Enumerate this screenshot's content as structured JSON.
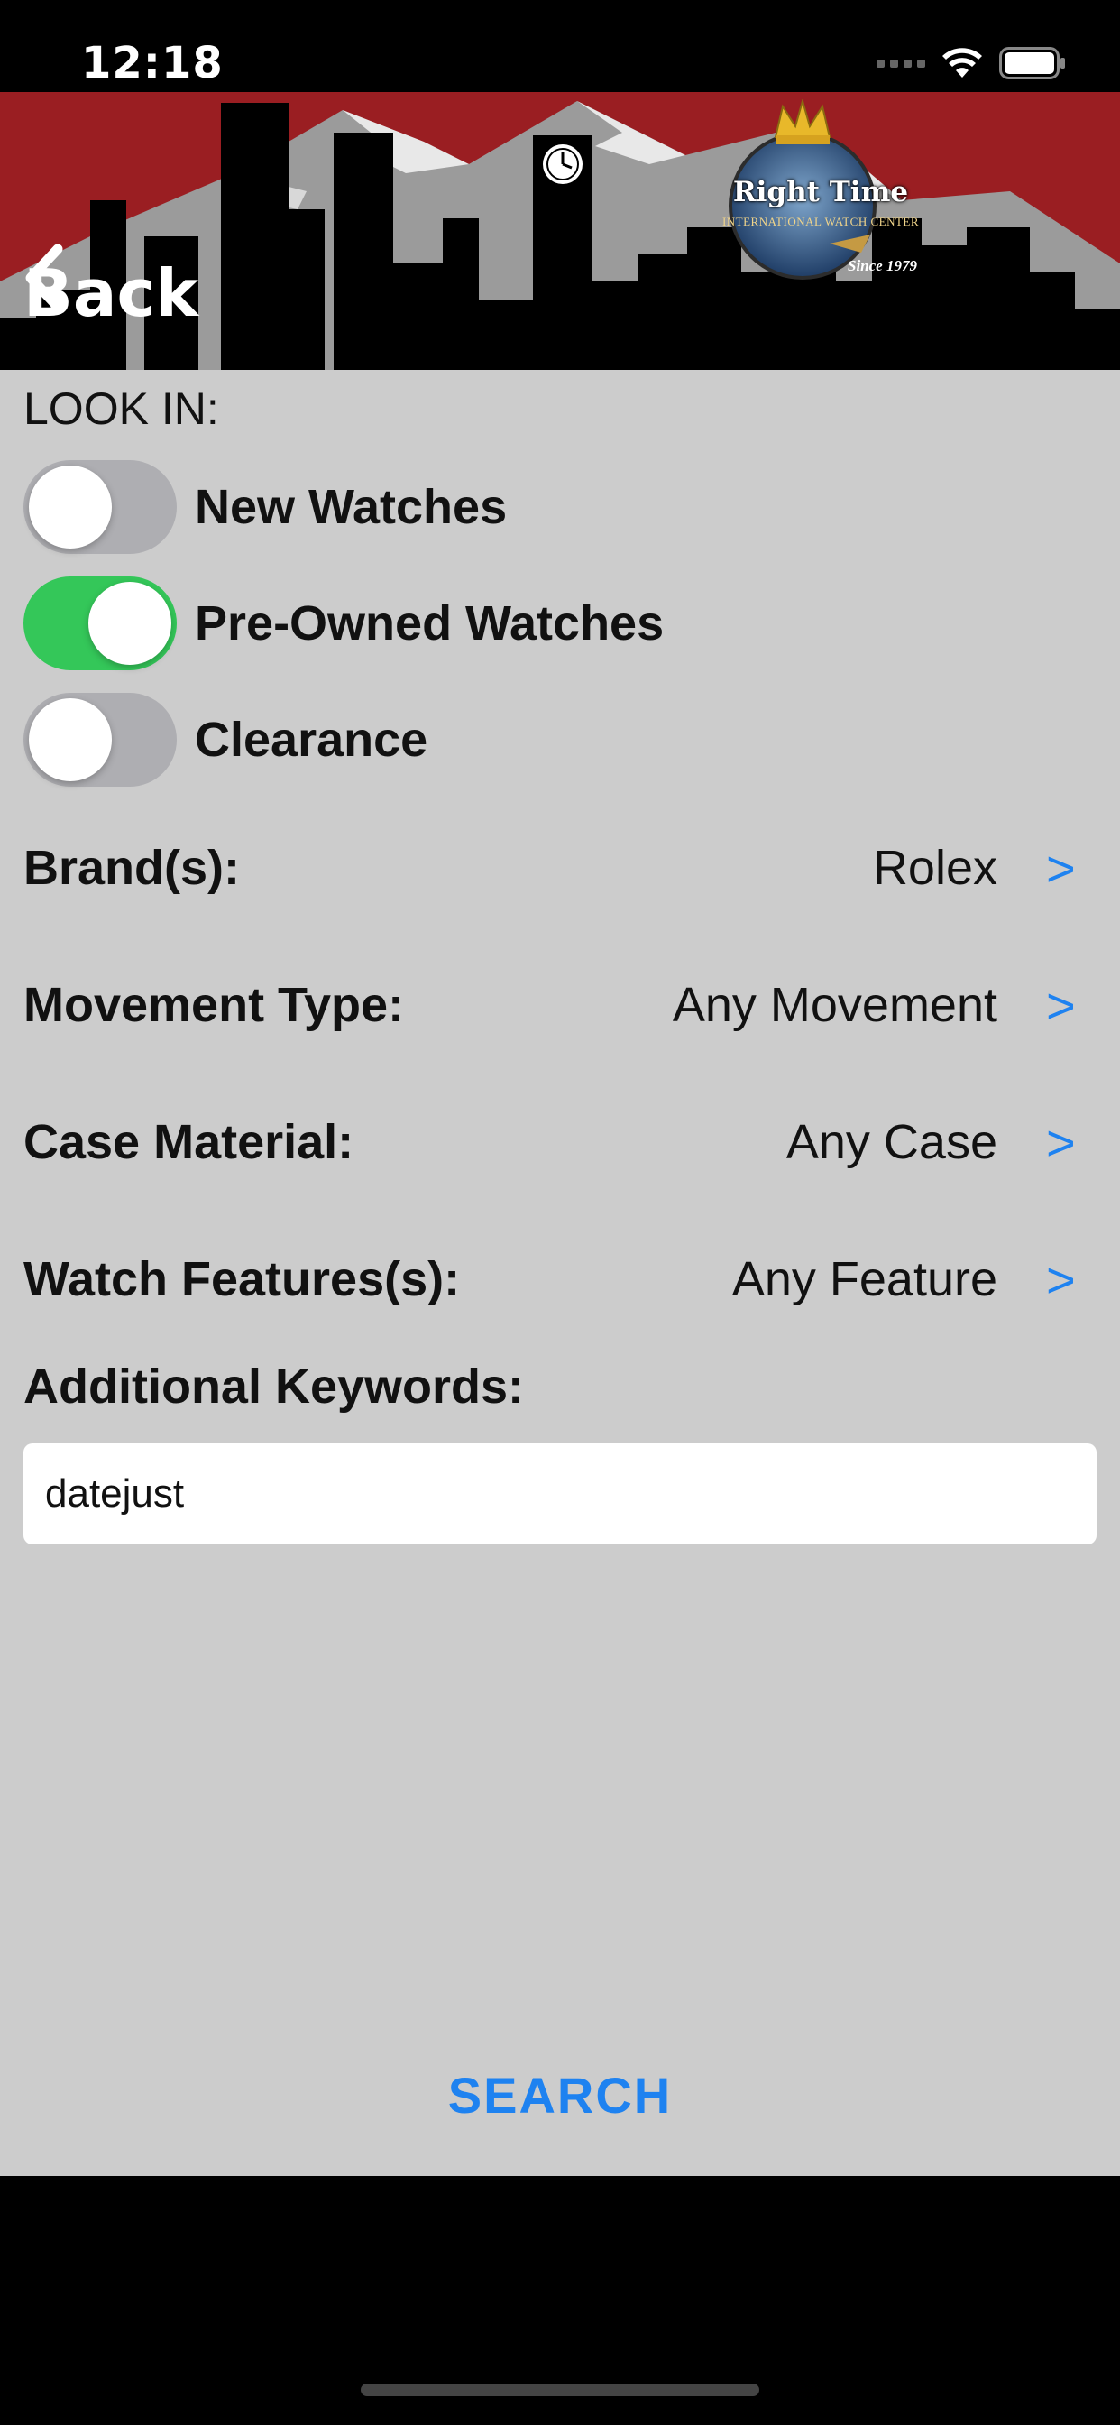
{
  "status_bar": {
    "time": "12:18"
  },
  "header": {
    "back_label": "Back",
    "logo": {
      "name": "Right Time",
      "subtitle": "INTERNATIONAL WATCH CENTER",
      "since": "Since 1979"
    }
  },
  "look_in": {
    "label": "LOOK IN:",
    "toggles": [
      {
        "label": "New Watches",
        "on": false
      },
      {
        "label": "Pre-Owned Watches",
        "on": true
      },
      {
        "label": "Clearance",
        "on": false
      }
    ]
  },
  "filters": [
    {
      "label": "Brand(s):",
      "value": "Rolex",
      "arrow": ">"
    },
    {
      "label": "Movement Type:",
      "value": "Any Movement",
      "arrow": ">"
    },
    {
      "label": "Case Material:",
      "value": "Any Case",
      "arrow": ">"
    },
    {
      "label": "Watch Features(s):",
      "value": "Any Feature",
      "arrow": ">"
    }
  ],
  "keywords": {
    "label": "Additional Keywords:",
    "value": "datejust"
  },
  "search_label": "SEARCH",
  "colors": {
    "header_red": "#9a1e22",
    "accent_blue": "#1e82f0",
    "toggle_on": "#34c759",
    "background": "#cccccc"
  }
}
